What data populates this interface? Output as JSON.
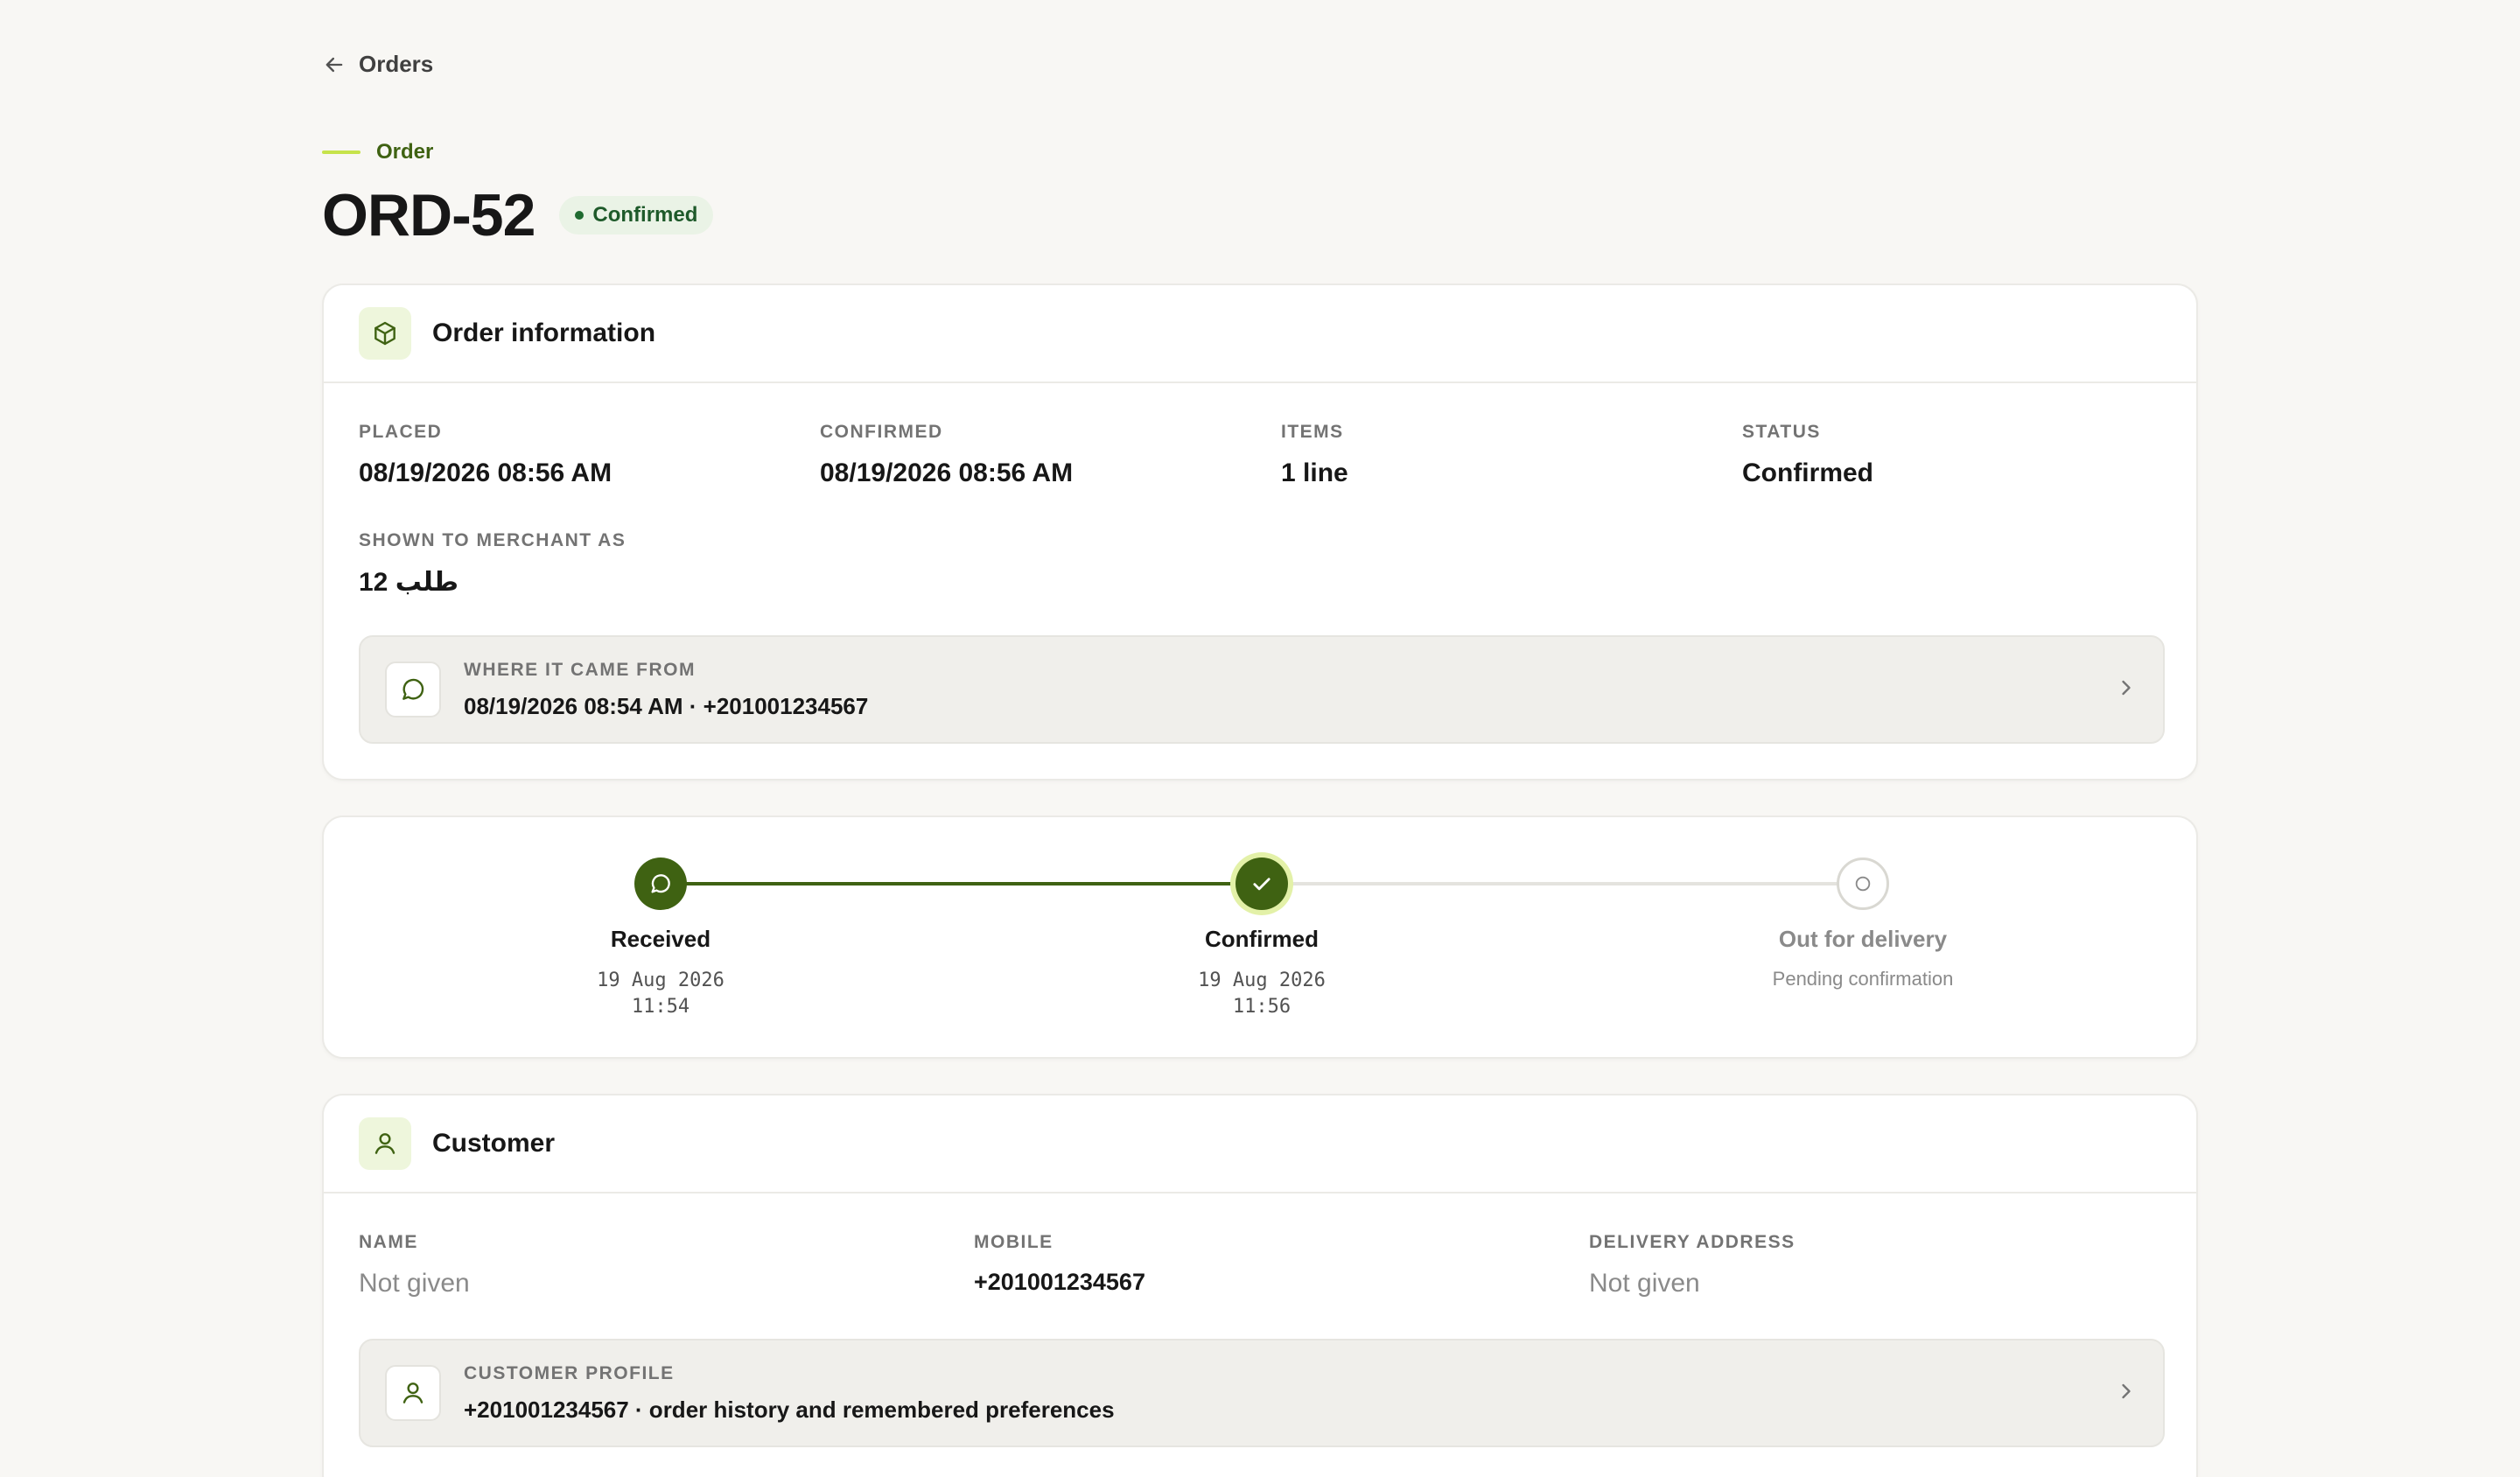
{
  "nav": {
    "back_label": "Orders"
  },
  "header": {
    "eyebrow": "Order",
    "title": "ORD-52",
    "status_badge": "Confirmed",
    "accent_color": "#3f6212",
    "badge_color": "#1f6b30"
  },
  "order_info": {
    "title": "Order information",
    "icon": "package-icon",
    "fields": [
      {
        "label": "PLACED",
        "value": "08/19/2026 08:56 AM"
      },
      {
        "label": "CONFIRMED",
        "value": "08/19/2026 08:56 AM"
      },
      {
        "label": "ITEMS",
        "value": "1 line"
      },
      {
        "label": "STATUS",
        "value": "Confirmed"
      }
    ],
    "merchant": {
      "label": "SHOWN TO MERCHANT AS",
      "value": "طلب 12"
    },
    "source": {
      "icon": "chat-bubble-icon",
      "label": "WHERE IT CAME FROM",
      "value": "08/19/2026 08:54 AM · +201001234567"
    }
  },
  "timeline": {
    "steps": [
      {
        "label": "Received",
        "date": "19 Aug 2026",
        "time": "11:54",
        "state": "done",
        "icon": "chat-bubble-icon"
      },
      {
        "label": "Confirmed",
        "date": "19 Aug 2026",
        "time": "11:56",
        "state": "current",
        "icon": "check-icon"
      },
      {
        "label": "Out for delivery",
        "note": "Pending confirmation",
        "state": "pending",
        "icon": "circle-icon"
      }
    ]
  },
  "customer": {
    "title": "Customer",
    "icon": "user-icon",
    "fields": [
      {
        "label": "NAME",
        "value": "Not given"
      },
      {
        "label": "MOBILE",
        "value": "+201001234567"
      },
      {
        "label": "DELIVERY ADDRESS",
        "value": "Not given"
      }
    ],
    "profile": {
      "icon": "user-icon",
      "label": "CUSTOMER PROFILE",
      "value": "+201001234567 · order history and remembered preferences"
    }
  }
}
